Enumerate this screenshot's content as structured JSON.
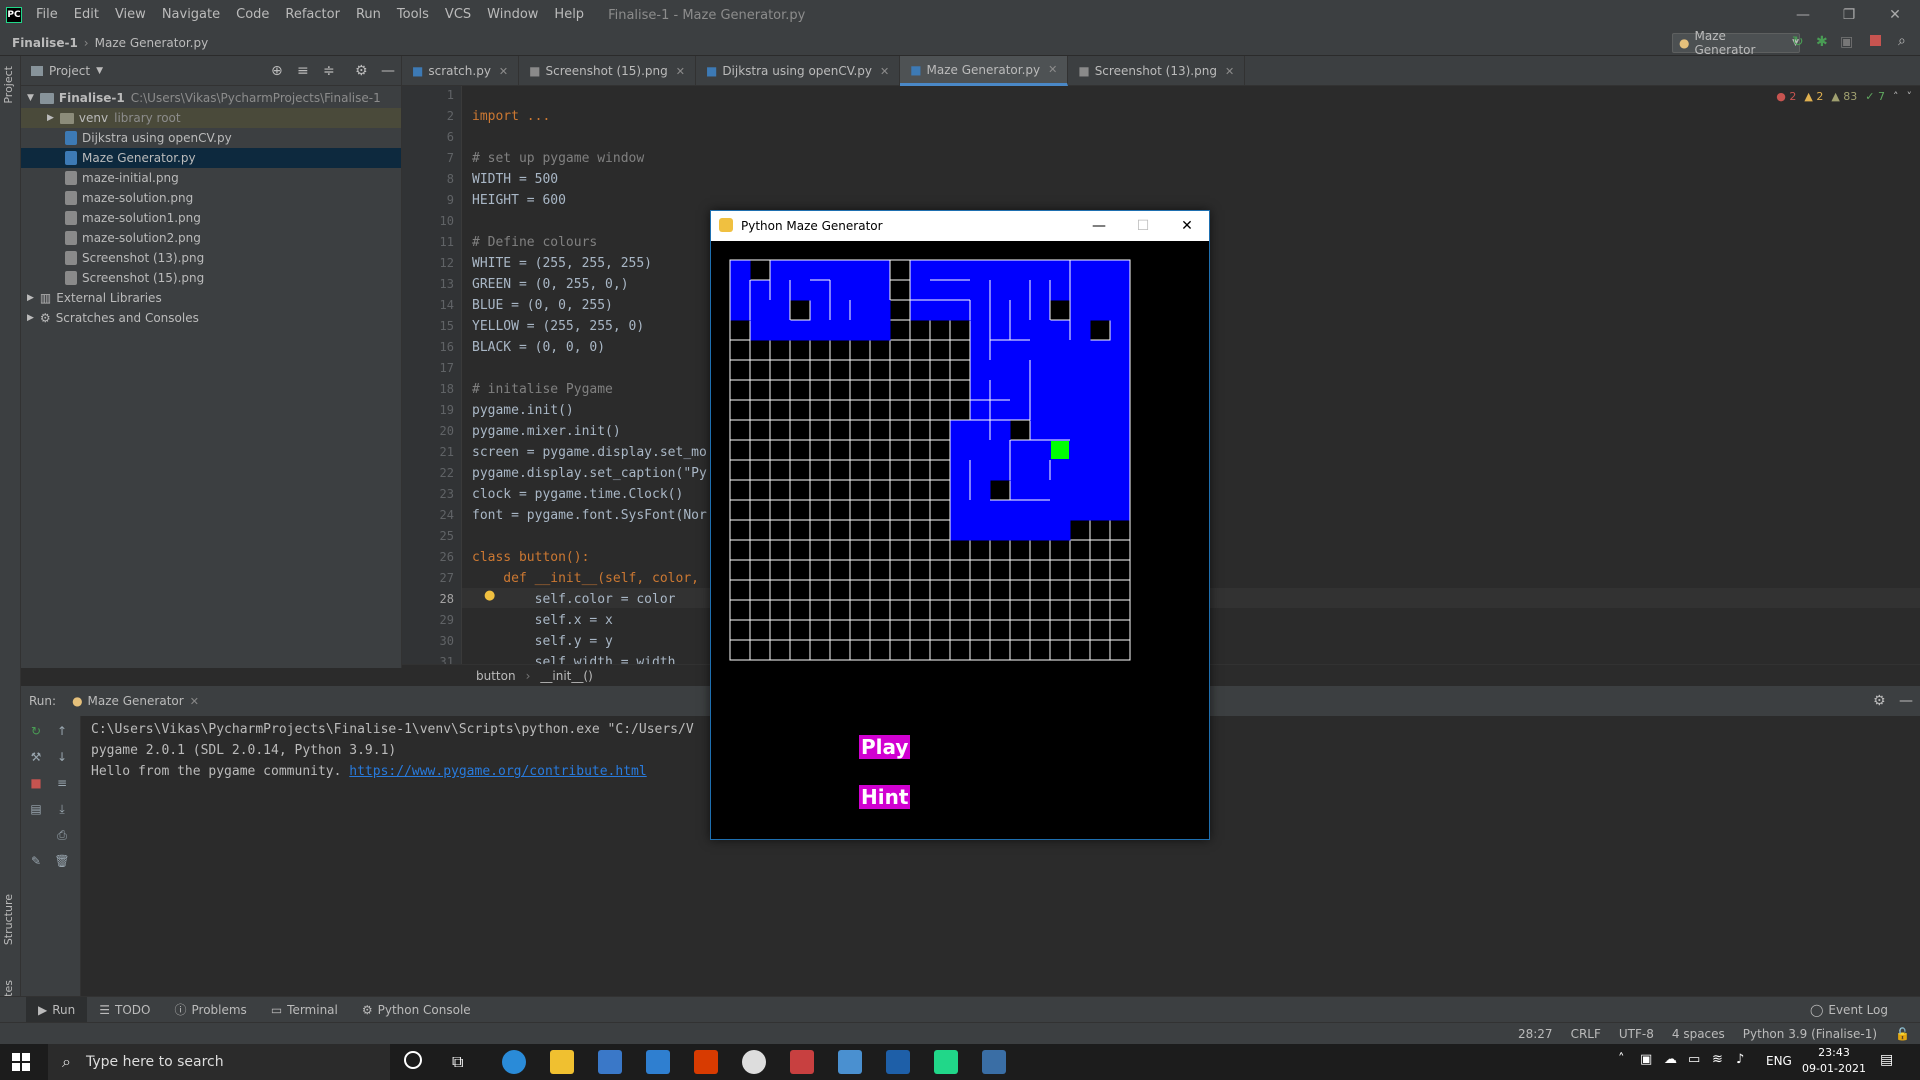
{
  "menu": {
    "app_icon": "PC",
    "items": [
      "File",
      "Edit",
      "View",
      "Navigate",
      "Code",
      "Refactor",
      "Run",
      "Tools",
      "VCS",
      "Window",
      "Help"
    ],
    "window_title": "Finalise-1 - Maze Generator.py"
  },
  "nav": {
    "project": "Finalise-1",
    "file": "Maze Generator.py",
    "run_config": "Maze Generator"
  },
  "project_panel": {
    "title": "Project",
    "root": {
      "name": "Finalise-1",
      "path": "C:\\Users\\Vikas\\PycharmProjects\\Finalise-1"
    },
    "venv": {
      "name": "venv",
      "note": "library root"
    },
    "files": [
      "Dijkstra using openCV.py",
      "Maze Generator.py",
      "maze-initial.png",
      "maze-solution.png",
      "maze-solution1.png",
      "maze-solution2.png",
      "Screenshot (13).png",
      "Screenshot (15).png"
    ],
    "external": "External Libraries",
    "scratches": "Scratches and Consoles"
  },
  "tabs": [
    "scratch.py",
    "Screenshot (15).png",
    "Dijkstra using openCV.py",
    "Maze Generator.py",
    "Screenshot (13).png"
  ],
  "editor": {
    "indicators": {
      "errors": "2",
      "warnings": "2",
      "weak": "83",
      "ok": "7"
    },
    "line_numbers": [
      "1",
      "2",
      "6",
      "7",
      "8",
      "9",
      "10",
      "11",
      "12",
      "13",
      "14",
      "15",
      "16",
      "17",
      "18",
      "19",
      "20",
      "21",
      "22",
      "23",
      "24",
      "25",
      "26",
      "27",
      "28",
      "29",
      "30",
      "31"
    ],
    "lines": [
      "",
      "import ...",
      "",
      "# set up pygame window",
      "WIDTH = 500",
      "HEIGHT = 600",
      "",
      "# Define colours",
      "WHITE = (255, 255, 255)",
      "GREEN = (0, 255, 0,)",
      "BLUE = (0, 0, 255)",
      "YELLOW = (255, 255, 0)",
      "BLACK = (0, 0, 0)",
      "",
      "# initalise Pygame",
      "pygame.init()",
      "pygame.mixer.init()",
      "screen = pygame.display.set_mo",
      "pygame.display.set_caption(\"Py",
      "clock = pygame.time.Clock()",
      "font = pygame.font.SysFont(Nor",
      "",
      "class button():",
      "    def __init__(self, color, ",
      "        self.color = color",
      "        self.x = x",
      "        self.y = y",
      "        self.width = width"
    ],
    "breadcrumb": [
      "button",
      "__init__()"
    ]
  },
  "run": {
    "label": "Run:",
    "config": "Maze Generator",
    "output": [
      "C:\\Users\\Vikas\\PycharmProjects\\Finalise-1\\venv\\Scripts\\python.exe \"C:/Users/V",
      "pygame 2.0.1 (SDL 2.0.14, Python 3.9.1)",
      "Hello from the pygame community. "
    ],
    "link": "https://www.pygame.org/contribute.html"
  },
  "bottom_tabs": [
    "Run",
    "TODO",
    "Problems",
    "Terminal",
    "Python Console"
  ],
  "event_log": "Event Log",
  "status": {
    "position": "28:27",
    "line_sep": "CRLF",
    "encoding": "UTF-8",
    "indent": "4 spaces",
    "interpreter": "Python 3.9 (Finalise-1)"
  },
  "side_tabs": {
    "project": "Project",
    "structure": "Structure",
    "favorites": "Favorites"
  },
  "pygame": {
    "title": "Python Maze Generator",
    "play": "Play",
    "hint": "Hint",
    "colors": {
      "wall": "#ffffff",
      "visited": "#0000ff",
      "current": "#00ff00",
      "bg": "#000000",
      "button": "#d100d1"
    }
  },
  "taskbar": {
    "search_placeholder": "Type here to search",
    "lang": "ENG",
    "time": "23:43",
    "date": "09-01-2021"
  }
}
